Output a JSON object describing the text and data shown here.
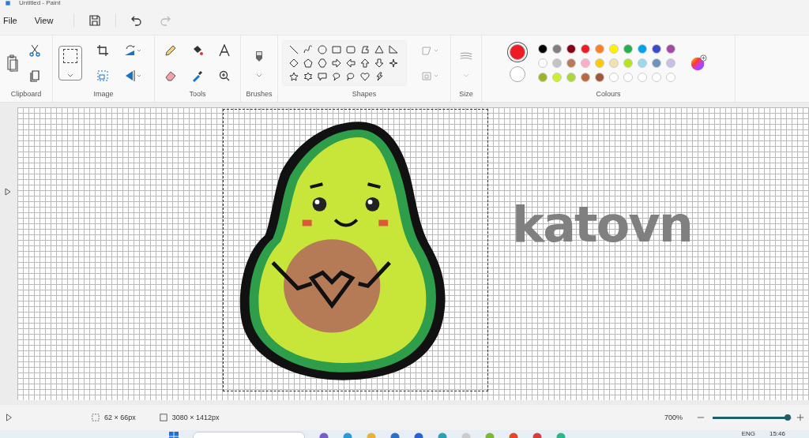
{
  "window": {
    "title": "Untitled - Paint"
  },
  "menu": [
    "File",
    "View"
  ],
  "ribbon": {
    "groups": [
      "Clipboard",
      "Image",
      "Tools",
      "Brushes",
      "Shapes",
      "Size",
      "Colours"
    ]
  },
  "colours": {
    "primary": {
      "color": "#ed1c24",
      "selected": true
    },
    "secondary": {
      "color": "#ffffff",
      "selected": false
    },
    "palette": [
      {
        "kind": "swatch",
        "color": "#000000"
      },
      {
        "kind": "swatch",
        "color": "#7f7f7f"
      },
      {
        "kind": "swatch",
        "color": "#880015"
      },
      {
        "kind": "swatch",
        "color": "#ed1c24"
      },
      {
        "kind": "swatch",
        "color": "#ff7f27"
      },
      {
        "kind": "swatch",
        "color": "#fff200"
      },
      {
        "kind": "swatch",
        "color": "#22b14c"
      },
      {
        "kind": "swatch",
        "color": "#00a2e8"
      },
      {
        "kind": "swatch",
        "color": "#3f48cc"
      },
      {
        "kind": "swatch",
        "color": "#a349a4"
      },
      {
        "kind": "swatch",
        "color": "#ffffff"
      },
      {
        "kind": "swatch",
        "color": "#c3c3c3"
      },
      {
        "kind": "swatch",
        "color": "#b97a57"
      },
      {
        "kind": "swatch",
        "color": "#ffaec9"
      },
      {
        "kind": "swatch",
        "color": "#ffc90e"
      },
      {
        "kind": "swatch",
        "color": "#efe4b0"
      },
      {
        "kind": "swatch",
        "color": "#b5e61d"
      },
      {
        "kind": "swatch",
        "color": "#99d9ea"
      },
      {
        "kind": "swatch",
        "color": "#7092be"
      },
      {
        "kind": "swatch",
        "color": "#c8bfe7"
      },
      {
        "kind": "swatch",
        "color": "#9ab52c"
      },
      {
        "kind": "swatch",
        "color": "#ccf02a"
      },
      {
        "kind": "swatch",
        "color": "#a8d83a"
      },
      {
        "kind": "swatch",
        "color": "#b86a40"
      },
      {
        "kind": "swatch",
        "color": "#a0583a"
      },
      {
        "kind": "empty"
      },
      {
        "kind": "empty"
      },
      {
        "kind": "empty"
      },
      {
        "kind": "empty"
      },
      {
        "kind": "empty"
      }
    ]
  },
  "canvas": {
    "handwriting": "katovn"
  },
  "status_bar": {
    "selection_size": "62 × 66px",
    "canvas_size": "3080 × 1412px",
    "zoom": "700%",
    "zoom_slider": {
      "level": 0.95
    }
  },
  "taskbar": {
    "language": "ENG",
    "time": "15:46"
  }
}
